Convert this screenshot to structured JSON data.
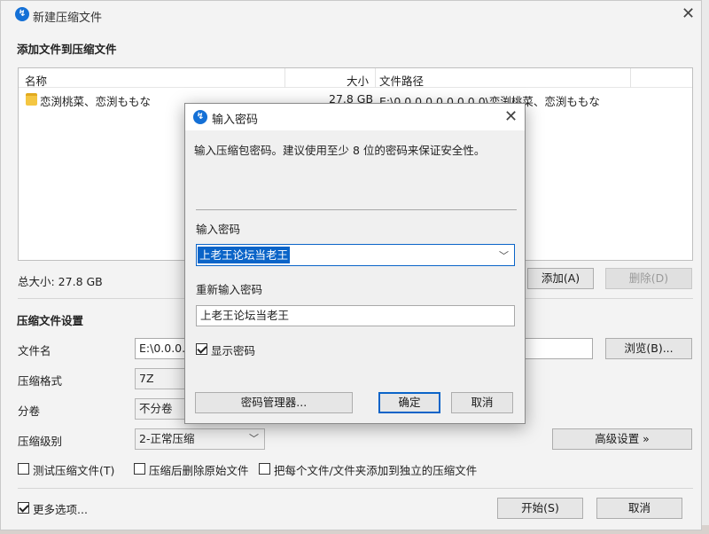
{
  "main": {
    "title": "新建压缩文件",
    "add_files_heading": "添加文件到压缩文件",
    "columns": [
      "名称",
      "大小",
      "文件路径"
    ],
    "files": [
      {
        "name": "恋渕桃菜、恋渕ももな",
        "size": "27.8 GB",
        "path": "E:\\0.0.0.0.0.0.0.0.0\\恋渕桃菜、恋渕ももな"
      }
    ],
    "total_size": "总大小: 27.8 GB",
    "add_button": "添加(A)",
    "delete_button": "删除(D)",
    "settings_heading": "压缩文件设置",
    "filename_label": "文件名",
    "filename_value": "E:\\0.0.0.0.",
    "browse_button": "浏览(B)...",
    "format_label": "压缩格式",
    "format_value": "7Z",
    "split_label": "分卷",
    "split_value": "不分卷",
    "level_label": "压缩级别",
    "level_value": "2-正常压缩",
    "advanced_button": "高级设置 »",
    "options": {
      "test": "测试压缩文件(T)",
      "delete_after": "压缩后删除原始文件",
      "separate": "把每个文件/文件夹添加到独立的压缩文件"
    },
    "more_options": "更多选项...",
    "more_options_checked": true,
    "start_button": "开始(S)",
    "cancel_button": "取消"
  },
  "dialog": {
    "title": "输入密码",
    "description": "输入压缩包密码。建议使用至少 8 位的密码来保证安全性。",
    "password_label": "输入密码",
    "password_value": "上老王论坛当老王",
    "reenter_label": "重新输入密码",
    "reenter_value": "上老王论坛当老王",
    "show_password": "显示密码",
    "show_password_checked": true,
    "manager_button": "密码管理器...",
    "ok_button": "确定",
    "cancel_button": "取消"
  },
  "colors": {
    "accent": "#0a64c8",
    "icon_blue": "#1470d6",
    "folder": "#f4c642"
  }
}
